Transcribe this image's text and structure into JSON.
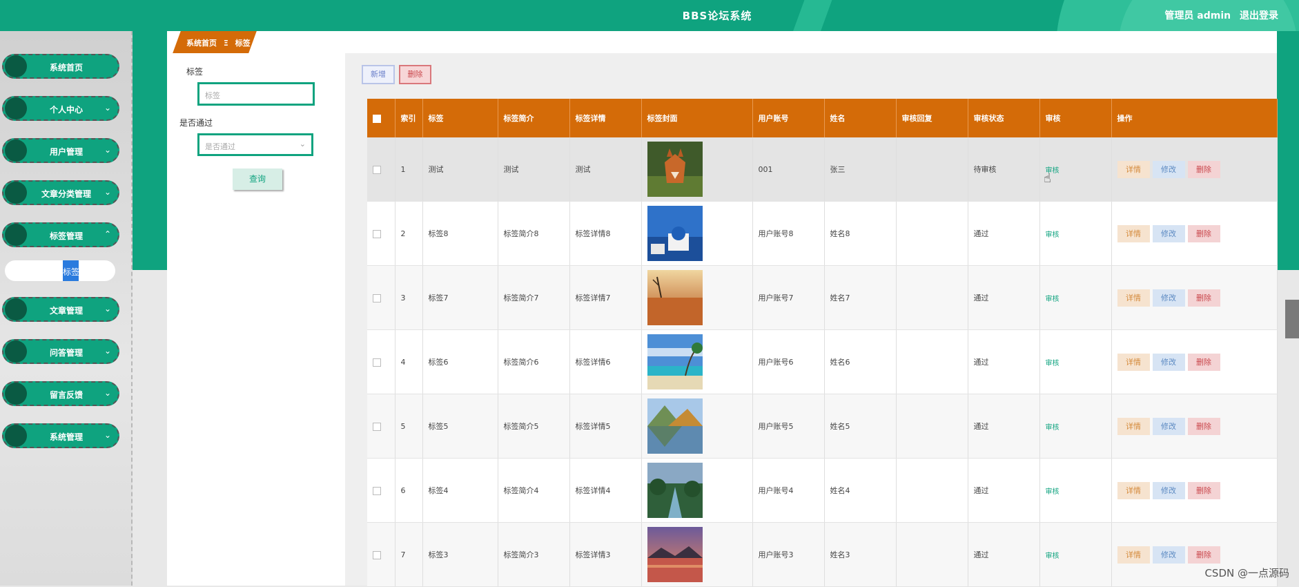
{
  "header": {
    "title": "BBS论坛系统",
    "user_label": "管理员 admin",
    "logout_label": "退出登录"
  },
  "sidebar": {
    "items": [
      {
        "label": "系统首页",
        "chevron": ""
      },
      {
        "label": "个人中心",
        "chevron": "⌄"
      },
      {
        "label": "用户管理",
        "chevron": "⌄"
      },
      {
        "label": "文章分类管理",
        "chevron": "⌄"
      },
      {
        "label": "标签管理",
        "chevron": "⌃"
      },
      {
        "label": "文章管理",
        "chevron": "⌄"
      },
      {
        "label": "问答管理",
        "chevron": "⌄"
      },
      {
        "label": "留言反馈",
        "chevron": "⌄"
      },
      {
        "label": "系统管理",
        "chevron": "⌄"
      }
    ],
    "submenu": {
      "label": "标签"
    }
  },
  "breadcrumb": {
    "home": "系统首页",
    "separator": "Ξ",
    "current": "标签"
  },
  "search": {
    "tag_label": "标签",
    "tag_placeholder": "标签",
    "pass_label": "是否通过",
    "pass_placeholder": "是否通过",
    "query_button": "查询"
  },
  "toolbar": {
    "add_label": "新增",
    "delete_label": "删除"
  },
  "table": {
    "columns": [
      "",
      "索引",
      "标签",
      "标签简介",
      "标签详情",
      "标签封面",
      "用户账号",
      "姓名",
      "审核回复",
      "审核状态",
      "审核",
      "操作"
    ],
    "audit_label": "审核",
    "detail_label": "详情",
    "edit_label": "修改",
    "delete_label": "删除",
    "rows": [
      {
        "index": "1",
        "tag": "测试",
        "intro": "测试",
        "detail": "测试",
        "cover": "fox",
        "account": "001",
        "name": "张三",
        "reply": "",
        "status": "待审核"
      },
      {
        "index": "2",
        "tag": "标签8",
        "intro": "标签简介8",
        "detail": "标签详情8",
        "cover": "santorini",
        "account": "用户账号8",
        "name": "姓名8",
        "reply": "",
        "status": "通过"
      },
      {
        "index": "3",
        "tag": "标签7",
        "intro": "标签简介7",
        "detail": "标签详情7",
        "cover": "desert",
        "account": "用户账号7",
        "name": "姓名7",
        "reply": "",
        "status": "通过"
      },
      {
        "index": "4",
        "tag": "标签6",
        "intro": "标签简介6",
        "detail": "标签详情6",
        "cover": "beach",
        "account": "用户账号6",
        "name": "姓名6",
        "reply": "",
        "status": "通过"
      },
      {
        "index": "5",
        "tag": "标签5",
        "intro": "标签简介5",
        "detail": "标签详情5",
        "cover": "lake",
        "account": "用户账号5",
        "name": "姓名5",
        "reply": "",
        "status": "通过"
      },
      {
        "index": "6",
        "tag": "标签4",
        "intro": "标签简介4",
        "detail": "标签详情4",
        "cover": "river",
        "account": "用户账号4",
        "name": "姓名4",
        "reply": "",
        "status": "通过"
      },
      {
        "index": "7",
        "tag": "标签3",
        "intro": "标签简介3",
        "detail": "标签详情3",
        "cover": "sunset",
        "account": "用户账号3",
        "name": "姓名3",
        "reply": "",
        "status": "通过"
      }
    ]
  },
  "watermark": "CSDN @一点源码",
  "colors": {
    "primary": "#0fa37f",
    "accent": "#d46b08"
  }
}
